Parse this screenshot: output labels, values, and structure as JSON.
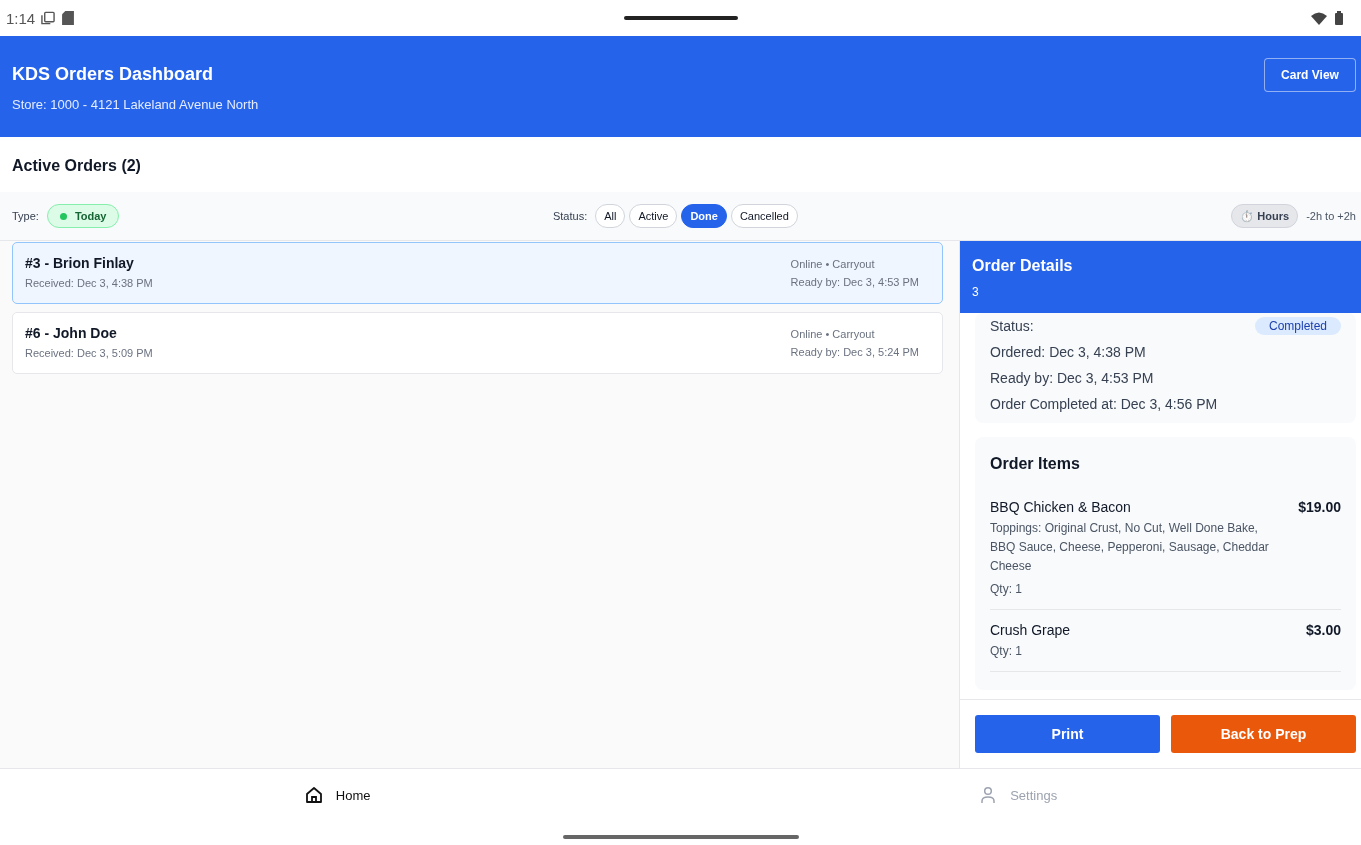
{
  "status_bar": {
    "time": "1:14"
  },
  "header": {
    "title": "KDS Orders Dashboard",
    "subtitle": "Store: 1000 - 4121 Lakeland Avenue North",
    "view_button": "Card View"
  },
  "section_title": "Active Orders (2)",
  "filters": {
    "type_label": "Type:",
    "type_chip": {
      "label": "Today",
      "color": "#22c55e"
    },
    "status_label": "Status:",
    "status_chips": [
      {
        "label": "All",
        "selected": false
      },
      {
        "label": "Active",
        "selected": false
      },
      {
        "label": "Done",
        "selected": true
      },
      {
        "label": "Cancelled",
        "selected": false
      }
    ],
    "hours_button": "⏱️ Hours",
    "range": "-2h to +2h"
  },
  "orders": [
    {
      "title": "#3 - Brion Finlay",
      "received": "Received: Dec 3, 4:38 PM",
      "channel": "Online • Carryout",
      "ready": "Ready by: Dec 3, 4:53 PM",
      "selected": true
    },
    {
      "title": "#6 - John Doe",
      "received": "Received: Dec 3, 5:09 PM",
      "channel": "Online • Carryout",
      "ready": "Ready by: Dec 3, 5:24 PM",
      "selected": false
    }
  ],
  "details": {
    "title": "Order Details",
    "number": "3",
    "status_label": "Status:",
    "status_badge": "Completed",
    "times": [
      "Ordered: Dec 3, 4:38 PM",
      "Ready by: Dec 3, 4:53 PM",
      "Order Completed at: Dec 3, 4:56 PM"
    ],
    "items_title": "Order Items",
    "items": [
      {
        "name": "BBQ Chicken & Bacon",
        "price": "$19.00",
        "toppings": "Toppings: Original Crust, No Cut, Well Done Bake, BBQ Sauce, Cheese, Pepperoni, Sausage, Cheddar Cheese",
        "qty": "Qty: 1"
      },
      {
        "name": "Crush Grape",
        "price": "$3.00",
        "qty": "Qty: 1"
      }
    ],
    "buttons": [
      {
        "label": "Print",
        "kind": "primary"
      },
      {
        "label": "Back to Prep",
        "kind": "warning"
      }
    ]
  },
  "bottom_nav": [
    {
      "label": "Home",
      "selected": true
    },
    {
      "label": "Settings",
      "selected": false
    }
  ]
}
